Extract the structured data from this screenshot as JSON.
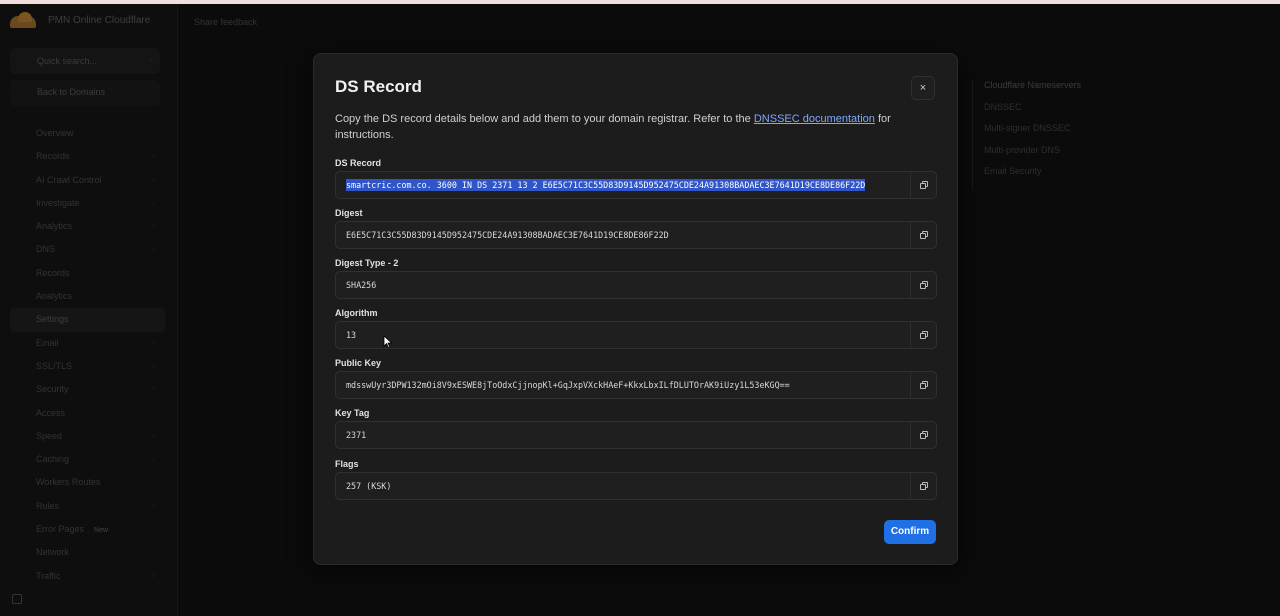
{
  "app": {
    "account_name": "PMN Online Cloudflare",
    "quick_search": "Quick search...",
    "back_to_domains": "Back to Domains",
    "header_feedback": "Share feedback",
    "nav_items": [
      {
        "label": "Overview",
        "has_arrow": false
      },
      {
        "label": "Records",
        "has_arrow": true
      },
      {
        "label": "AI Crawl Control",
        "has_arrow": true
      },
      {
        "label": "Investigate",
        "has_arrow": true
      },
      {
        "label": "Analytics",
        "has_arrow": true
      },
      {
        "label": "DNS",
        "has_arrow": true
      },
      {
        "label": "Records",
        "has_arrow": false
      },
      {
        "label": "Analytics",
        "has_arrow": false
      },
      {
        "label": "Settings",
        "has_arrow": false,
        "active": true
      },
      {
        "label": "Email",
        "has_arrow": true
      },
      {
        "label": "SSL/TLS",
        "has_arrow": true
      },
      {
        "label": "Security",
        "has_arrow": true
      },
      {
        "label": "Access",
        "has_arrow": false
      },
      {
        "label": "Speed",
        "has_arrow": true
      },
      {
        "label": "Caching",
        "has_arrow": true
      },
      {
        "label": "Workers Routes",
        "has_arrow": false
      },
      {
        "label": "Rules",
        "has_arrow": true
      },
      {
        "label": "Error Pages",
        "has_arrow": false,
        "badge": "New"
      },
      {
        "label": "Network",
        "has_arrow": false
      },
      {
        "label": "Traffic",
        "has_arrow": true
      }
    ],
    "right_panel": {
      "title": "Cloudflare Nameservers",
      "items": [
        "DNSSEC",
        "Multi-signer DNSSEC",
        "Multi-provider DNS",
        "Email Security"
      ]
    }
  },
  "modal": {
    "title": "DS Record",
    "description_before": "Copy the DS record details below and add them to your domain registrar. Refer to the ",
    "description_link": "DNSSEC documentation",
    "description_after": " for instructions.",
    "fields": [
      {
        "label": "DS Record",
        "value": "smartcric.com.co. 3600 IN DS 2371 13 2 E6E5C71C3C55D83D9145D952475CDE24A91308BADAEC3E7641D19CE8DE86F22D",
        "selected": true
      },
      {
        "label": "Digest",
        "value": "E6E5C71C3C55D83D9145D952475CDE24A91308BADAEC3E7641D19CE8DE86F22D"
      },
      {
        "label": "Digest Type - 2",
        "value": "SHA256"
      },
      {
        "label": "Algorithm",
        "value": "13"
      },
      {
        "label": "Public Key",
        "value": "mdsswUyr3DPW132mOi8V9xESWE8jToOdxCjjnopKl+GqJxpVXckHAeF+KkxLbxILfDLUTOrAK9iUzy1L53eKGQ=="
      },
      {
        "label": "Key Tag",
        "value": "2371"
      },
      {
        "label": "Flags",
        "value": "257 (KSK)"
      }
    ],
    "confirm_label": "Confirm",
    "close_label": "×"
  },
  "colors": {
    "accent": "#1f6fe5",
    "link": "#7ea8ff",
    "selection": "#2f55c8"
  }
}
